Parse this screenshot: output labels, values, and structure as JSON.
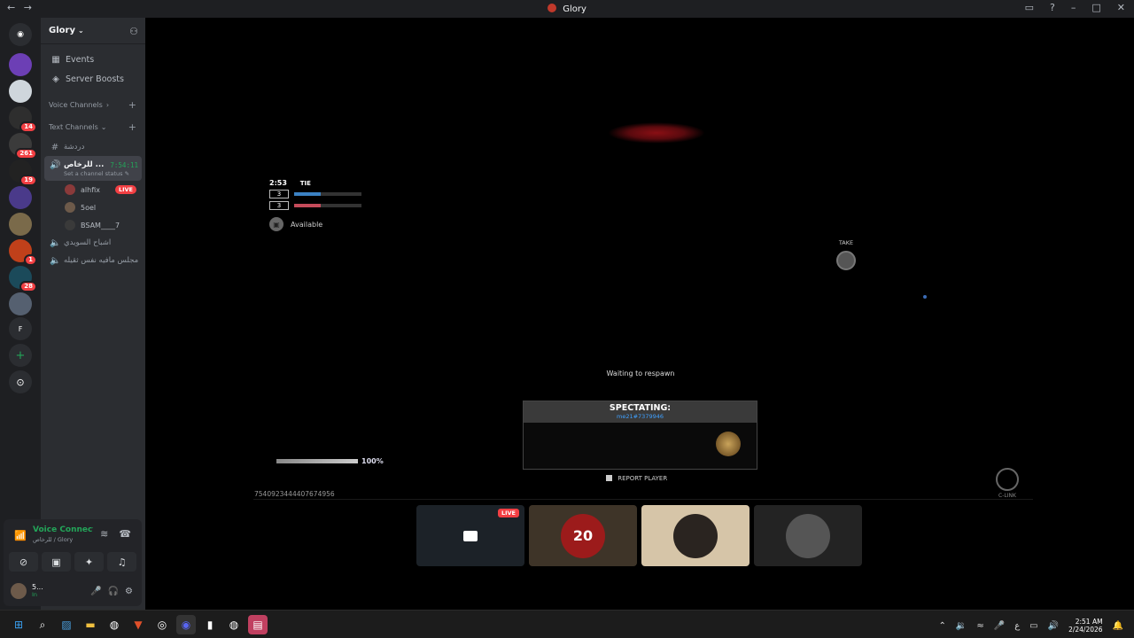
{
  "window": {
    "title": "Glory",
    "nav_back": "←",
    "nav_fwd": "→"
  },
  "rail": {
    "discord_home": "Discord",
    "servers": [
      {
        "name": "server-1",
        "color": "#6c3fb5",
        "badge": ""
      },
      {
        "name": "server-2",
        "color": "#cfd6dc",
        "badge": ""
      },
      {
        "name": "server-3",
        "color": "#2e2e2e",
        "badge": "14"
      },
      {
        "name": "server-4",
        "color": "#3b3b3b",
        "badge": "261"
      },
      {
        "name": "server-5",
        "color": "#222222",
        "badge": "19"
      },
      {
        "name": "server-6",
        "color": "#4a3a8a",
        "badge": ""
      },
      {
        "name": "server-7",
        "color": "#7a6a4a",
        "badge": ""
      },
      {
        "name": "server-8",
        "color": "#c0401a",
        "badge": "1"
      },
      {
        "name": "server-9",
        "color": "#1b4a5a",
        "badge": "28"
      },
      {
        "name": "server-10",
        "color": "#556070",
        "badge": ""
      }
    ],
    "folder_label": "F",
    "add_server": "+",
    "explore": "⊙"
  },
  "sidebar": {
    "guild_name": "Glory",
    "nav": [
      {
        "label": "Events",
        "icon": "calendar-icon"
      },
      {
        "label": "Server Boosts",
        "icon": "boost-icon"
      }
    ],
    "voice_category": "Voice Channels",
    "text_category": "Text Channels",
    "text_channel": "دردشة",
    "active_channel": {
      "name": "للرخاص ...",
      "timer": "7:54:11",
      "status": "Set a channel status"
    },
    "members": [
      {
        "name": "alhfix",
        "live": "LIVE",
        "color": "#8a3a3a"
      },
      {
        "name": "5oel",
        "live": "",
        "color": "#6d5a4a"
      },
      {
        "name": "BSAM____7",
        "live": "",
        "color": "#3a3a3a"
      }
    ],
    "voice_channels": [
      {
        "name": "اشباح السويدي"
      },
      {
        "name": "مجلس مافيه نفس ثقيله"
      }
    ]
  },
  "voice_panel": {
    "status": "Voice Connected",
    "sub": "للرخاص / Glory",
    "user_name": "5...",
    "user_status": "In"
  },
  "game": {
    "timer": "2:53",
    "tie": "TIE",
    "team1_score": "3",
    "team2_score": "3",
    "team1_color": "#3b82c4",
    "team2_color": "#c44b5a",
    "available": "Available",
    "take": "TAKE",
    "waiting": "Waiting to respawn",
    "spectating": "SPECTATING:",
    "spectated_player": "me21#7379946",
    "report": "REPORT PLAYER",
    "health_pct": "100%",
    "player_id": "7540923444407674956",
    "clink": "C-LINK"
  },
  "tiles": [
    {
      "type": "stream",
      "live": "LIVE"
    },
    {
      "type": "participant",
      "label": "20"
    },
    {
      "type": "participant",
      "label": ""
    },
    {
      "type": "participant",
      "label": ""
    }
  ],
  "taskbar": {
    "time": "2:51 AM",
    "date": "2/24/2026",
    "lang": "ع"
  }
}
